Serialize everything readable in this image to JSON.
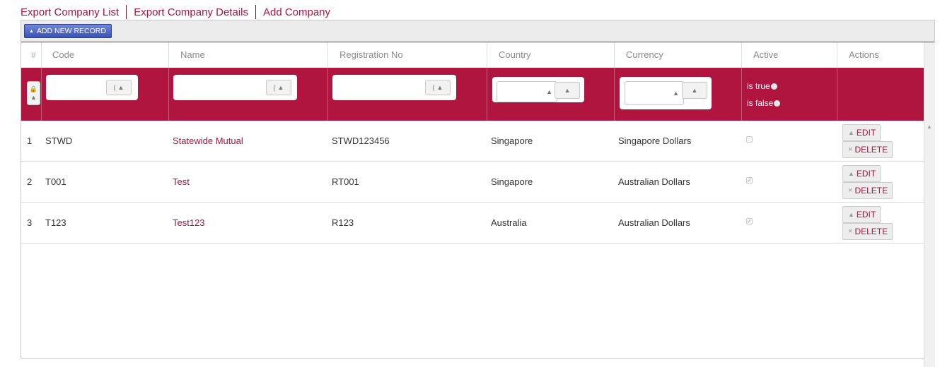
{
  "top_links": [
    "Export Company List",
    "Export Company Details",
    "Add Company"
  ],
  "toolbar": {
    "add_label": "ADD NEW RECORD"
  },
  "headers": {
    "num": "#",
    "code": "Code",
    "name": "Name",
    "reg": "Registration No",
    "country": "Country",
    "currency": "Currency",
    "active": "Active",
    "actions": "Actions"
  },
  "filter": {
    "is_true": "is true",
    "is_false": "is false"
  },
  "rows": [
    {
      "num": "1",
      "code": "STWD",
      "name": "Statewide Mutual",
      "reg": "STWD123456",
      "country": "Singapore",
      "currency": "Singapore Dollars",
      "active": false
    },
    {
      "num": "2",
      "code": "T001",
      "name": "Test",
      "reg": "RT001",
      "country": "Singapore",
      "currency": "Australian Dollars",
      "active": true
    },
    {
      "num": "3",
      "code": "T123",
      "name": "Test123",
      "reg": "R123",
      "country": "Australia",
      "currency": "Australian Dollars",
      "active": true
    }
  ],
  "actions": {
    "edit": "EDIT",
    "delete": "DELETE"
  },
  "colors": {
    "accent": "#a8143e",
    "filter_bg": "#b01540",
    "toolbar_btn": "#3b53b6"
  }
}
